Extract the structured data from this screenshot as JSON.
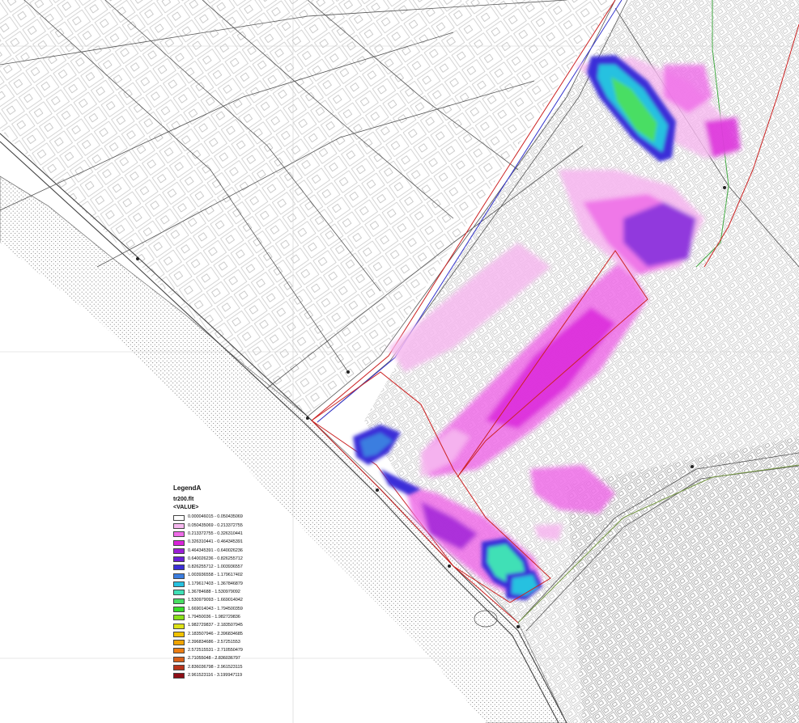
{
  "legend": {
    "title": "LegendA",
    "layer": "tr200.flt",
    "field": "<VALUE>",
    "classes": [
      {
        "range": "0.000046015 - 0.050435069",
        "color": "#ffffff"
      },
      {
        "range": "0.050435069 - 0.213372755",
        "color": "#f6b8ef"
      },
      {
        "range": "0.213372755 - 0.326310441",
        "color": "#ef6ce8"
      },
      {
        "range": "0.326310441 - 0.464345391",
        "color": "#d923d9"
      },
      {
        "range": "0.464345391 - 0.640026236",
        "color": "#9b1fd6"
      },
      {
        "range": "0.640026236 - 0.826255712",
        "color": "#6a20d8"
      },
      {
        "range": "0.826255712 - 1.003936557",
        "color": "#3a2fd8"
      },
      {
        "range": "1.003936558 - 1.179617402",
        "color": "#3b7ee0"
      },
      {
        "range": "1.179617403 - 1.367846879",
        "color": "#27c1e0"
      },
      {
        "range": "1.36784688 - 1.530979092",
        "color": "#3fe0b6"
      },
      {
        "range": "1.530979093 - 1.669014042",
        "color": "#48de64"
      },
      {
        "range": "1.669014043 - 1.794500359",
        "color": "#37de2a"
      },
      {
        "range": "1.79450036 - 1.982729836",
        "color": "#8ae01a"
      },
      {
        "range": "1.982729837 - 2.183507945",
        "color": "#dde117"
      },
      {
        "range": "2.183507946 - 2.396834685",
        "color": "#f2c200"
      },
      {
        "range": "2.396834686 - 2.57251553",
        "color": "#f0a400"
      },
      {
        "range": "2.572515531 - 2.710550479",
        "color": "#ec7d12"
      },
      {
        "range": "2.71055048 - 2.836036797",
        "color": "#d8601a"
      },
      {
        "range": "2.836036798 - 2.961523115",
        "color": "#b8341c"
      },
      {
        "range": "2.961523116 - 3.199947119",
        "color": "#8e0d16"
      }
    ]
  }
}
